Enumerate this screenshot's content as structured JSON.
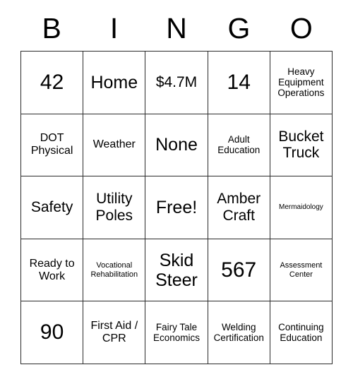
{
  "card": {
    "header_letters": [
      "B",
      "I",
      "N",
      "G",
      "O"
    ],
    "free_space_label": "Free!",
    "rows": [
      [
        {
          "text": "42",
          "size": "sz-xl"
        },
        {
          "text": "Home",
          "size": "sz-lg"
        },
        {
          "text": "$4.7M",
          "size": "sz-md"
        },
        {
          "text": "14",
          "size": "sz-xl"
        },
        {
          "text": "Heavy Equipment Operations",
          "size": "sz-xs"
        }
      ],
      [
        {
          "text": "DOT Physical",
          "size": "sz-sm"
        },
        {
          "text": "Weather",
          "size": "sz-sm"
        },
        {
          "text": "None",
          "size": "sz-lg"
        },
        {
          "text": "Adult Education",
          "size": "sz-xs"
        },
        {
          "text": "Bucket Truck",
          "size": "sz-md"
        }
      ],
      [
        {
          "text": "Safety",
          "size": "sz-md"
        },
        {
          "text": "Utility Poles",
          "size": "sz-md"
        },
        {
          "text": "Free!",
          "size": "sz-lg"
        },
        {
          "text": "Amber Craft",
          "size": "sz-md"
        },
        {
          "text": "Mermaidology",
          "size": "sz-tiny"
        }
      ],
      [
        {
          "text": "Ready to Work",
          "size": "sz-sm"
        },
        {
          "text": "Vocational Rehabilitation",
          "size": "sz-xxs"
        },
        {
          "text": "Skid Steer",
          "size": "sz-lg"
        },
        {
          "text": "567",
          "size": "sz-xl"
        },
        {
          "text": "Assessment Center",
          "size": "sz-xxs"
        }
      ],
      [
        {
          "text": "90",
          "size": "sz-xl"
        },
        {
          "text": "First Aid / CPR",
          "size": "sz-sm"
        },
        {
          "text": "Fairy Tale Economics",
          "size": "sz-xs"
        },
        {
          "text": "Welding Certification",
          "size": "sz-xs"
        },
        {
          "text": "Continuing Education",
          "size": "sz-xs"
        }
      ]
    ],
    "colors": {
      "border": "#2b2b2b",
      "text": "#000000",
      "background": "#ffffff"
    }
  }
}
